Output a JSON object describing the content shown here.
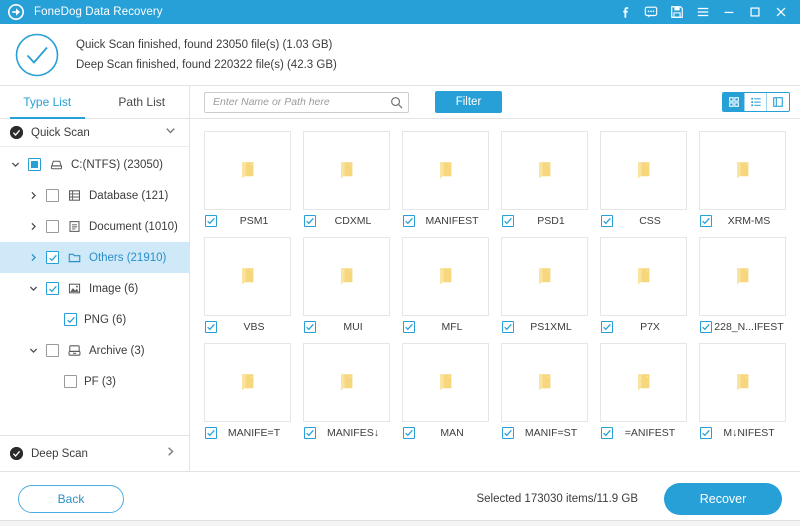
{
  "titlebar": {
    "app_title": "FoneDog Data Recovery",
    "logo_icon": "recovery-logo-icon",
    "icons": [
      {
        "name": "facebook-icon",
        "glyph": "f"
      },
      {
        "name": "feedback-chat-icon",
        "glyph": "chat"
      },
      {
        "name": "save-icon",
        "glyph": "floppy"
      },
      {
        "name": "menu-icon",
        "glyph": "hamburger"
      },
      {
        "name": "minimize-icon",
        "glyph": "minus"
      },
      {
        "name": "maximize-icon",
        "glyph": "square"
      },
      {
        "name": "close-icon",
        "glyph": "cross"
      }
    ],
    "bg_color": "#27a0d8"
  },
  "status": {
    "check_icon": "check-circle-icon",
    "quick_scan_text": "Quick Scan finished, found 23050 file(s) (1.03 GB)",
    "deep_scan_text": "Deep Scan finished, found 220322 file(s) (42.3 GB)"
  },
  "sidebar": {
    "tabs": [
      {
        "label": "Type List",
        "active": true
      },
      {
        "label": "Path List",
        "active": false
      }
    ],
    "quick_scan": {
      "label": "Quick Scan",
      "icon": "check-dot-icon",
      "caret": "chevron-down-icon"
    },
    "deep_scan": {
      "label": "Deep Scan",
      "icon": "check-dot-icon",
      "caret": "chevron-right-icon"
    },
    "tree": [
      {
        "label": "C:(NTFS) (23050)",
        "indent": 0,
        "arrow": "chevron-down",
        "check": "filled",
        "icon": "drive-icon",
        "selected": false
      },
      {
        "label": "Database (121)",
        "indent": 1,
        "arrow": "chevron-right",
        "check": "empty",
        "icon": "database-icon",
        "selected": false
      },
      {
        "label": "Document (1010)",
        "indent": 1,
        "arrow": "chevron-right",
        "check": "empty",
        "icon": "document-icon",
        "selected": false
      },
      {
        "label": "Others (21910)",
        "indent": 1,
        "arrow": "chevron-right",
        "check": "checked",
        "icon": "folder-icon",
        "selected": true
      },
      {
        "label": "Image (6)",
        "indent": 1,
        "arrow": "chevron-down",
        "check": "checked",
        "icon": "image-icon",
        "selected": false
      },
      {
        "label": "PNG (6)",
        "indent": 2,
        "arrow": "none",
        "check": "checked",
        "icon": "none",
        "selected": false
      },
      {
        "label": "Archive (3)",
        "indent": 1,
        "arrow": "chevron-down",
        "check": "empty",
        "icon": "archive-icon",
        "selected": false
      },
      {
        "label": "PF (3)",
        "indent": 2,
        "arrow": "none",
        "check": "empty",
        "icon": "none",
        "selected": false
      }
    ]
  },
  "toolbar": {
    "search_placeholder": "Enter Name or Path here",
    "search_value": "",
    "search_icon": "search-icon",
    "filter_label": "Filter",
    "views": [
      {
        "name": "grid-view-button",
        "icon": "grid-icon",
        "active": true
      },
      {
        "name": "list-view-button",
        "icon": "list-icon",
        "active": false
      },
      {
        "name": "detail-view-button",
        "icon": "split-panel-icon",
        "active": false
      }
    ]
  },
  "grid": {
    "icon": "folder-icon",
    "items": [
      {
        "name": "PSM1",
        "checked": true
      },
      {
        "name": "CDXML",
        "checked": true
      },
      {
        "name": "MANIFEST",
        "checked": true
      },
      {
        "name": "PSD1",
        "checked": true
      },
      {
        "name": "CSS",
        "checked": true
      },
      {
        "name": "XRM-MS",
        "checked": true
      },
      {
        "name": "VBS",
        "checked": true
      },
      {
        "name": "MUI",
        "checked": true
      },
      {
        "name": "MFL",
        "checked": true
      },
      {
        "name": "PS1XML",
        "checked": true
      },
      {
        "name": "P7X",
        "checked": true
      },
      {
        "name": "228_N...IFEST",
        "checked": true
      },
      {
        "name": "MANIFE=T",
        "checked": true
      },
      {
        "name": "MANIFES↓",
        "checked": true
      },
      {
        "name": "MAN",
        "checked": true
      },
      {
        "name": "MANIF=ST",
        "checked": true
      },
      {
        "name": "=ANIFEST",
        "checked": true
      },
      {
        "name": "M↓NIFEST",
        "checked": true
      }
    ]
  },
  "footer": {
    "back_label": "Back",
    "selected_info": "Selected 173030 items/11.9 GB",
    "recover_label": "Recover"
  },
  "colors": {
    "accent": "#27a0d8",
    "selected_row": "#cfe9f9",
    "folder": "#f6d77d"
  }
}
